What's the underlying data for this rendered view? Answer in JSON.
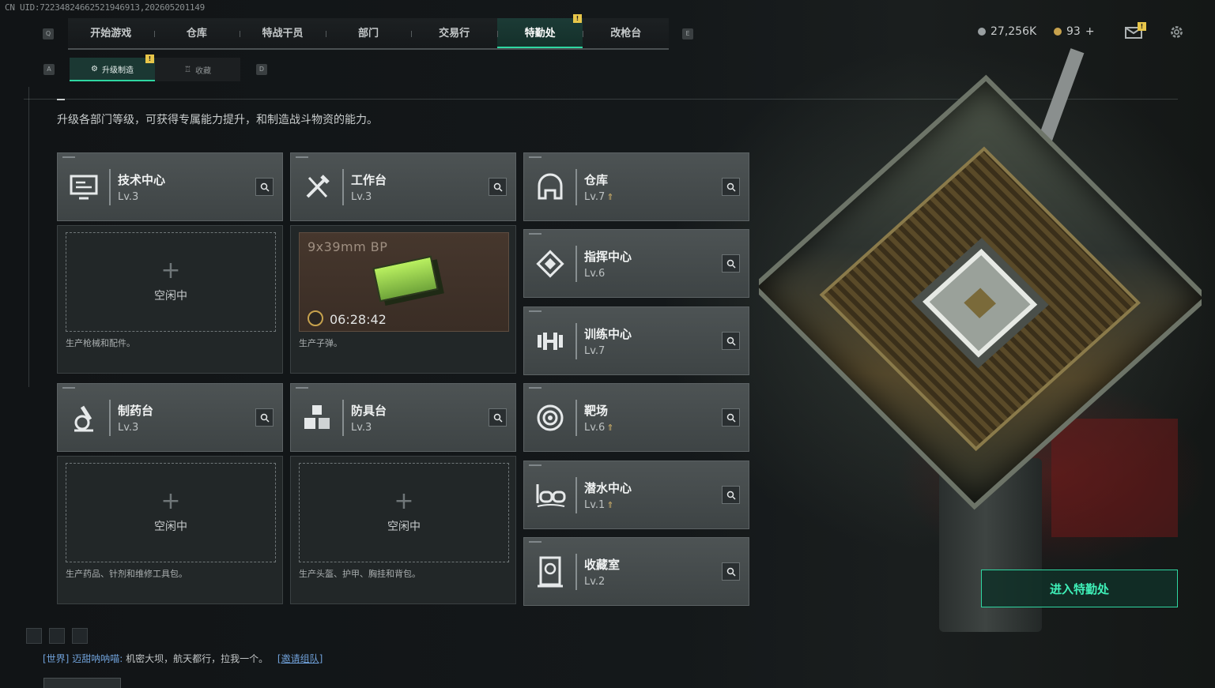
{
  "uid_text": "CN UID:7223482466252194691​3,202605201149",
  "nav": {
    "left_key": "Q",
    "right_key": "E",
    "tabs": [
      "开始游戏",
      "仓库",
      "特战干员",
      "部门",
      "交易行",
      "特勤处",
      "改枪台"
    ],
    "active_index": 5,
    "badge": "!"
  },
  "currency": {
    "silver": "27,256K",
    "gold": "93",
    "gold_add": "+"
  },
  "mail_badge": "!",
  "subtabs": {
    "left_key": "A",
    "right_key": "D",
    "items": [
      {
        "label": "升级制造",
        "active": true
      },
      {
        "label": "收藏",
        "active": false
      }
    ],
    "badge": "!"
  },
  "description": "升级各部门等级，可获得专属能力提升，和制造战斗物资的能力。",
  "departments": [
    {
      "name": "技术中心",
      "level": "Lv.3",
      "upgradable": false,
      "icon": "monitor-icon"
    },
    {
      "name": "工作台",
      "level": "Lv.3",
      "upgradable": false,
      "icon": "tools-icon"
    },
    {
      "name": "仓库",
      "level": "Lv.7",
      "upgradable": true,
      "icon": "warehouse-icon"
    },
    {
      "name": "指挥中心",
      "level": "Lv.6",
      "upgradable": false,
      "icon": "command-icon"
    },
    {
      "name": "训练中心",
      "level": "Lv.7",
      "upgradable": false,
      "icon": "dumbbell-icon"
    },
    {
      "name": "制药台",
      "level": "Lv.3",
      "upgradable": false,
      "icon": "microscope-icon"
    },
    {
      "name": "防具台",
      "level": "Lv.3",
      "upgradable": false,
      "icon": "cubes-icon"
    },
    {
      "name": "靶场",
      "level": "Lv.6",
      "upgradable": true,
      "icon": "target-icon"
    },
    {
      "name": "潜水中心",
      "level": "Lv.1",
      "upgradable": true,
      "icon": "goggles-icon"
    },
    {
      "name": "收藏室",
      "level": "Lv.2",
      "upgradable": false,
      "icon": "trophy-icon"
    }
  ],
  "slots": {
    "tech": {
      "idle": "空闲中",
      "note": "生产枪械和配件。"
    },
    "workbench": {
      "item": "9x39mm BP",
      "timer": "06:28:42",
      "note": "生产子弹。"
    },
    "pharmacy": {
      "idle": "空闲中",
      "note": "生产药品、针剂和维修工具包。"
    },
    "armor": {
      "idle": "空闲中",
      "note": "生产头盔、护甲、胸挂和背包。"
    }
  },
  "enter_button": "进入特勤处",
  "chat": {
    "channel": "[世界]",
    "user": "迈甜呐呐喵:",
    "message": "机密大坝，航天都行，拉我一个。",
    "invite": "[邀请组队]"
  },
  "colors": {
    "accent": "#2fd6a1",
    "badge": "#e8c64a",
    "upgrade": "#d6b46a"
  }
}
